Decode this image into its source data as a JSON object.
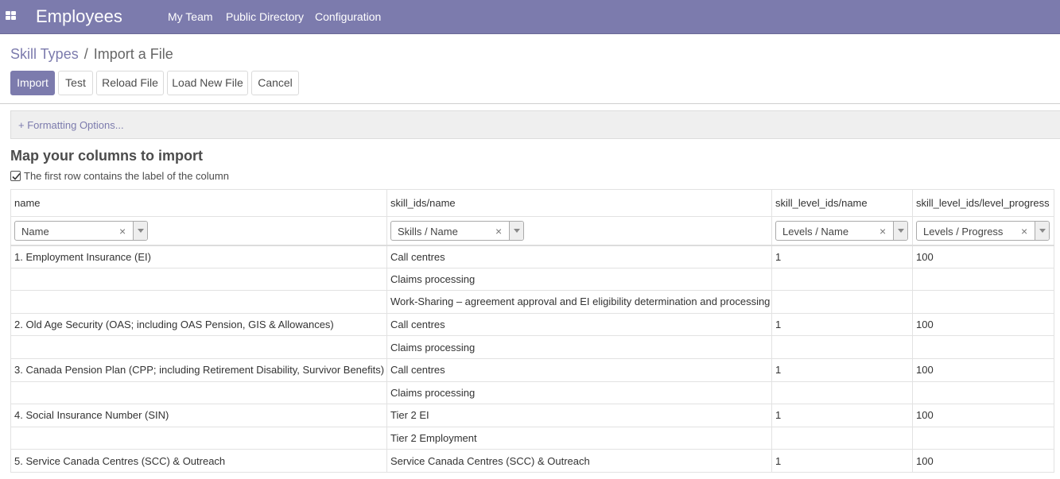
{
  "navbar": {
    "brand": "Employees",
    "menu": [
      "My Team",
      "Public Directory",
      "Configuration"
    ],
    "color": "#7c7bad"
  },
  "breadcrumb": {
    "parent": "Skill Types",
    "separator": "/",
    "current": "Import a File"
  },
  "buttons": {
    "import": "Import",
    "test": "Test",
    "reload": "Reload File",
    "load_new": "Load New File",
    "cancel": "Cancel"
  },
  "formatting_options": "+ Formatting Options...",
  "mapping": {
    "title": "Map your columns to import",
    "header_checkbox_checked": true,
    "header_checkbox_label": "The first row contains the label of the column",
    "columns": [
      {
        "name": "name",
        "field": "Name"
      },
      {
        "name": "skill_ids/name",
        "field": "Skills / Name"
      },
      {
        "name": "skill_level_ids/name",
        "field": "Levels / Name"
      },
      {
        "name": "skill_level_ids/level_progress",
        "field": "Levels / Progress"
      }
    ],
    "rows": [
      [
        "1. Employment Insurance (EI)",
        "Call centres",
        "1",
        "100"
      ],
      [
        "",
        "Claims processing",
        "",
        ""
      ],
      [
        "",
        "Work-Sharing – agreement approval and EI eligibility determination and processing",
        "",
        ""
      ],
      [
        "2. Old Age Security (OAS; including OAS Pension, GIS & Allowances)",
        "Call centres",
        "1",
        "100"
      ],
      [
        "",
        "Claims processing",
        "",
        ""
      ],
      [
        "3. Canada Pension Plan (CPP; including Retirement Disability, Survivor Benefits)",
        "Call centres",
        "1",
        "100"
      ],
      [
        "",
        "Claims processing",
        "",
        ""
      ],
      [
        "4. Social Insurance Number (SIN)",
        "Tier 2 EI",
        "1",
        "100"
      ],
      [
        "",
        "Tier 2 Employment",
        "",
        ""
      ],
      [
        "5. Service Canada Centres (SCC) & Outreach",
        "Service Canada Centres (SCC) & Outreach",
        "1",
        "100"
      ]
    ]
  }
}
